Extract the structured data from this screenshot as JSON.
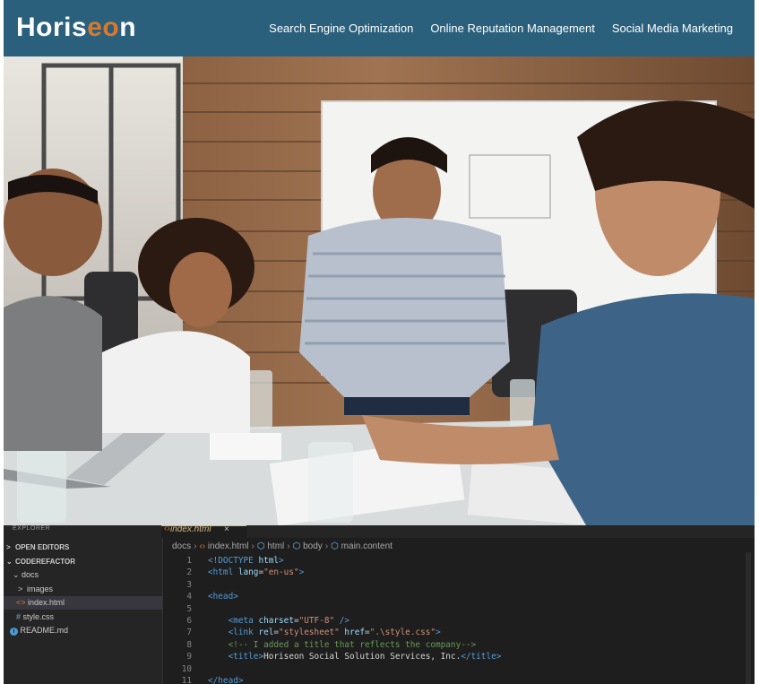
{
  "site": {
    "logo_main": "Horis",
    "logo_accent": "eo",
    "logo_end": "n",
    "nav": [
      "Search Engine Optimization",
      "Online Reputation Management",
      "Social Media Marketing"
    ],
    "brand_bg": "#2a607c",
    "accent": "#d9782d"
  },
  "editor": {
    "explorer_title": "EXPLORER",
    "tab_label": "index.html",
    "tab_close": "×",
    "sidebar": [
      {
        "label": "OPEN EDITORS",
        "chevron": ">",
        "kind": "section"
      },
      {
        "label": "CODEREFACTOR",
        "chevron": "⌄",
        "kind": "section"
      },
      {
        "label": "docs",
        "chevron": "⌄",
        "kind": "folder"
      },
      {
        "label": "images",
        "chevron": ">",
        "kind": "folder"
      },
      {
        "label": "index.html",
        "icon": "<>",
        "kind": "file",
        "active": true
      },
      {
        "label": "style.css",
        "icon": "#",
        "kind": "file"
      },
      {
        "label": "README.md",
        "icon": "i",
        "kind": "file"
      }
    ],
    "breadcrumb": [
      "docs",
      "index.html",
      "html",
      "body",
      "main.content"
    ],
    "code_lines": [
      {
        "n": "1",
        "parts": [
          [
            "t-tag",
            "<!DOCTYPE "
          ],
          [
            "t-attr",
            "html"
          ],
          [
            "t-tag",
            ">"
          ]
        ]
      },
      {
        "n": "2",
        "parts": [
          [
            "t-tag",
            "<html "
          ],
          [
            "t-attr",
            "lang"
          ],
          [
            "t-txt",
            "="
          ],
          [
            "t-str",
            "\"en-us\""
          ],
          [
            "t-tag",
            ">"
          ]
        ]
      },
      {
        "n": "3",
        "parts": []
      },
      {
        "n": "4",
        "parts": [
          [
            "t-tag",
            "<head>"
          ]
        ]
      },
      {
        "n": "5",
        "parts": []
      },
      {
        "n": "6",
        "parts": [
          [
            "t-txt",
            "    "
          ],
          [
            "t-tag",
            "<meta "
          ],
          [
            "t-attr",
            "charset"
          ],
          [
            "t-txt",
            "="
          ],
          [
            "t-str",
            "\"UTF-8\""
          ],
          [
            "t-tag",
            " />"
          ]
        ]
      },
      {
        "n": "7",
        "parts": [
          [
            "t-txt",
            "    "
          ],
          [
            "t-tag",
            "<link "
          ],
          [
            "t-attr",
            "rel"
          ],
          [
            "t-txt",
            "="
          ],
          [
            "t-str",
            "\"stylesheet\""
          ],
          [
            "t-attr",
            " href"
          ],
          [
            "t-txt",
            "="
          ],
          [
            "t-str",
            "\".\\style.css\""
          ],
          [
            "t-tag",
            ">"
          ]
        ]
      },
      {
        "n": "8",
        "parts": [
          [
            "t-txt",
            "    "
          ],
          [
            "t-com",
            "<!-- I added a title that reflects the company-->"
          ]
        ]
      },
      {
        "n": "9",
        "parts": [
          [
            "t-txt",
            "    "
          ],
          [
            "t-tag",
            "<title>"
          ],
          [
            "t-txt",
            "Horiseon Social Solution Services, Inc."
          ],
          [
            "t-tag",
            "</title>"
          ]
        ]
      },
      {
        "n": "10",
        "parts": []
      },
      {
        "n": "11",
        "parts": [
          [
            "t-tag",
            "</head>"
          ]
        ]
      }
    ]
  }
}
